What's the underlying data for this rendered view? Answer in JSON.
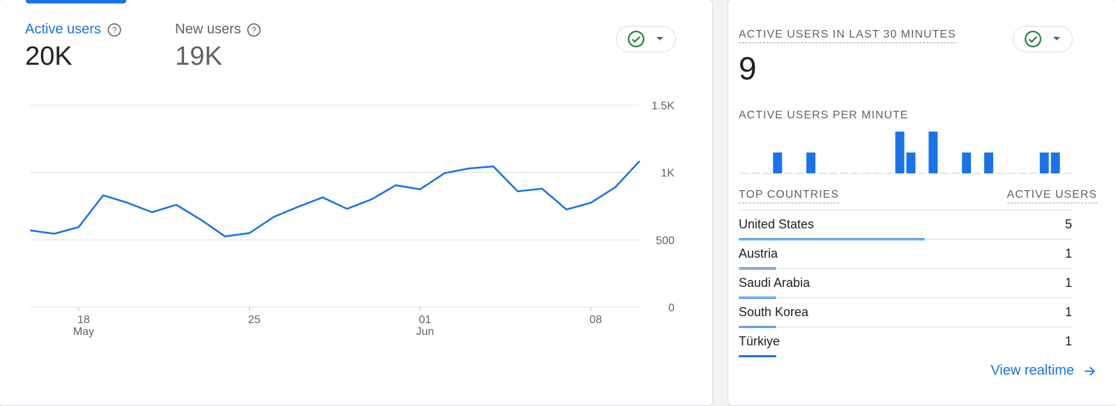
{
  "overview": {
    "metrics": [
      {
        "label": "Active users",
        "value": "20K"
      },
      {
        "label": "New users",
        "value": "19K"
      }
    ]
  },
  "chart_data": {
    "type": "line",
    "x": [
      "May 16",
      "May 17",
      "May 18",
      "May 19",
      "May 20",
      "May 21",
      "May 22",
      "May 23",
      "May 24",
      "May 25",
      "May 26",
      "May 27",
      "May 28",
      "May 29",
      "May 30",
      "May 31",
      "Jun 01",
      "Jun 02",
      "Jun 03",
      "Jun 04",
      "Jun 05",
      "Jun 06",
      "Jun 07",
      "Jun 08",
      "Jun 09",
      "Jun 10"
    ],
    "series": [
      {
        "values": [
          570,
          545,
          595,
          830,
          775,
          705,
          760,
          650,
          525,
          550,
          670,
          745,
          815,
          730,
          800,
          905,
          875,
          995,
          1030,
          1045,
          860,
          880,
          725,
          775,
          890,
          1085
        ],
        "color": "#1a73e8"
      }
    ],
    "xticks": [
      {
        "x": "May 18",
        "label": "18",
        "sub": "May"
      },
      {
        "x": "May 25",
        "label": "25",
        "sub": ""
      },
      {
        "x": "Jun 01",
        "label": "01",
        "sub": "Jun"
      },
      {
        "x": "Jun 08",
        "label": "08",
        "sub": ""
      }
    ],
    "yticks": [
      "0",
      "500",
      "1K",
      "1.5K"
    ],
    "ylim": [
      0,
      1500
    ],
    "grid": true
  },
  "realtime": {
    "title": "ACTIVE USERS IN LAST 30 MINUTES",
    "count": "9",
    "per_minute_title": "ACTIVE USERS PER MINUTE",
    "per_minute": [
      0,
      0,
      0,
      1,
      0,
      0,
      1,
      0,
      0,
      0,
      0,
      0,
      0,
      0,
      2,
      1,
      0,
      2,
      0,
      0,
      1,
      0,
      1,
      0,
      0,
      0,
      0,
      1,
      1,
      0
    ],
    "countries_header": "TOP COUNTRIES",
    "users_header": "ACTIVE USERS",
    "countries": [
      {
        "name": "United States",
        "value": "5"
      },
      {
        "name": "Austria",
        "value": "1"
      },
      {
        "name": "Saudi Arabia",
        "value": "1"
      },
      {
        "name": "South Korea",
        "value": "1"
      },
      {
        "name": "Türkiye",
        "value": "1"
      }
    ],
    "view_link": "View realtime"
  },
  "colors": {
    "accent": "#1a73e8",
    "check": "#188038",
    "grid": "#e0e0e0"
  }
}
